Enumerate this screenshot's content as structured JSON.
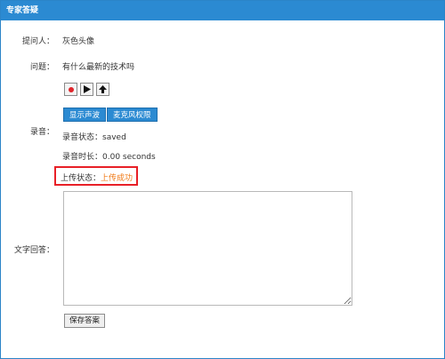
{
  "dialog": {
    "title": "专家答疑"
  },
  "questioner": {
    "label": "提问人：",
    "value": "灰色头像"
  },
  "question": {
    "label": "问题：",
    "value": "有什么最新的技术吗"
  },
  "recording": {
    "label": "录音：",
    "controls": [
      "record-icon",
      "play-icon",
      "upload-icon"
    ],
    "show_waveform_label": "显示声波",
    "mic_permission_label": "麦克风权限",
    "status_label": "录音状态：",
    "status_value": "saved",
    "duration_label": "录音时长：",
    "duration_value": "0.00 seconds",
    "upload_label": "上传状态：",
    "upload_value": "上传成功"
  },
  "text_answer": {
    "label": "文字回答：",
    "value": ""
  },
  "save_label": "保存答案",
  "colors": {
    "accent": "#2b8ad2",
    "success_text": "#f07a16",
    "highlight_border": "#e82027",
    "record_dot": "#e0252b"
  }
}
